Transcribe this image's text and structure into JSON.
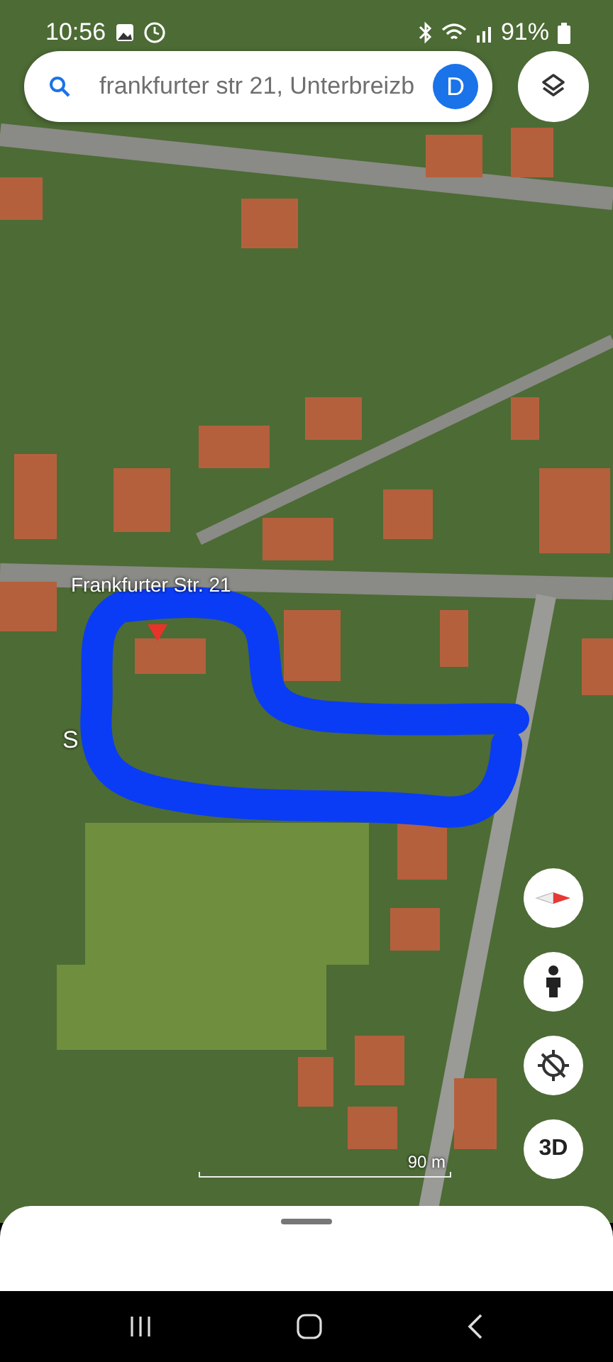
{
  "status_bar": {
    "time": "10:56",
    "battery": "91%"
  },
  "search": {
    "value": "frankfurter str 21, Unterbreizb",
    "avatar": "D"
  },
  "map": {
    "street_label": "Frankfurter Str. 21",
    "partial_label": "S",
    "scale": "90 m"
  },
  "controls": [
    {
      "kind": "compass"
    },
    {
      "kind": "pegman"
    },
    {
      "kind": "location"
    },
    {
      "kind": "label",
      "label": "3D"
    }
  ]
}
